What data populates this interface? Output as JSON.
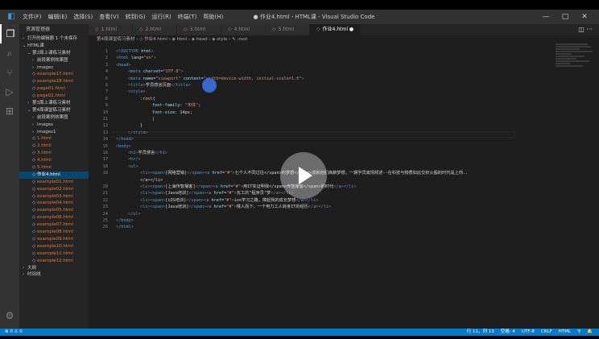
{
  "window": {
    "title": "● 作业4.html - HTML课 - Visual Studio Code",
    "menu": [
      "文件(F)",
      "编辑(E)",
      "选择(S)",
      "查看(V)",
      "转到(G)",
      "运行(R)",
      "终端(T)",
      "帮助(H)"
    ],
    "controls": [
      "—",
      "□",
      "✕"
    ]
  },
  "activity_bar": [
    "files-icon",
    "search-icon",
    "source-control-icon",
    "debug-icon",
    "extensions-icon"
  ],
  "sidebar": {
    "title": "资源管理器",
    "items": [
      {
        "label": "打开的编辑器  1 个未保存",
        "indent": 0,
        "twisty": "›",
        "kind": "folder"
      },
      {
        "label": "HTML课",
        "indent": 0,
        "twisty": "⌄",
        "kind": "folder"
      },
      {
        "label": "第2周上课练习素材",
        "indent": 1,
        "twisty": "⌄",
        "kind": "folder"
      },
      {
        "label": "前段案例效果图",
        "indent": 2,
        "twisty": "›",
        "kind": "folder"
      },
      {
        "label": "images",
        "indent": 2,
        "twisty": "›",
        "kind": "folder"
      },
      {
        "label": "example17.html",
        "indent": 2,
        "twisty": "",
        "kind": "html"
      },
      {
        "label": "example18.html",
        "indent": 2,
        "twisty": "",
        "kind": "html"
      },
      {
        "label": "page01.html",
        "indent": 2,
        "twisty": "",
        "kind": "html"
      },
      {
        "label": "page02.html",
        "indent": 2,
        "twisty": "",
        "kind": "html"
      },
      {
        "label": "第3周上课练习素材",
        "indent": 1,
        "twisty": "›",
        "kind": "folder"
      },
      {
        "label": "第4周课堂练习素材",
        "indent": 1,
        "twisty": "⌄",
        "kind": "folder"
      },
      {
        "label": "前段案例效果图",
        "indent": 2,
        "twisty": "›",
        "kind": "folder"
      },
      {
        "label": "images",
        "indent": 2,
        "twisty": "›",
        "kind": "folder"
      },
      {
        "label": "images1",
        "indent": 2,
        "twisty": "›",
        "kind": "folder"
      },
      {
        "label": "1.html",
        "indent": 2,
        "twisty": "",
        "kind": "html"
      },
      {
        "label": "2.html",
        "indent": 2,
        "twisty": "",
        "kind": "html"
      },
      {
        "label": "3.html",
        "indent": 2,
        "twisty": "",
        "kind": "html"
      },
      {
        "label": "4.html",
        "indent": 2,
        "twisty": "",
        "kind": "html"
      },
      {
        "label": "5.html",
        "indent": 2,
        "twisty": "",
        "kind": "html"
      },
      {
        "label": "作业4.html",
        "indent": 2,
        "twisty": "",
        "kind": "active"
      },
      {
        "label": "example01.html",
        "indent": 2,
        "twisty": "",
        "kind": "html"
      },
      {
        "label": "example02.html",
        "indent": 2,
        "twisty": "",
        "kind": "html"
      },
      {
        "label": "example03.html",
        "indent": 2,
        "twisty": "",
        "kind": "html"
      },
      {
        "label": "example04.html",
        "indent": 2,
        "twisty": "",
        "kind": "html"
      },
      {
        "label": "example05.html",
        "indent": 2,
        "twisty": "",
        "kind": "html"
      },
      {
        "label": "example06.html",
        "indent": 2,
        "twisty": "",
        "kind": "html"
      },
      {
        "label": "example07.html",
        "indent": 2,
        "twisty": "",
        "kind": "html"
      },
      {
        "label": "example08.html",
        "indent": 2,
        "twisty": "",
        "kind": "html"
      },
      {
        "label": "example09.html",
        "indent": 2,
        "twisty": "",
        "kind": "html"
      },
      {
        "label": "example10.html",
        "indent": 2,
        "twisty": "",
        "kind": "html"
      },
      {
        "label": "example11.html",
        "indent": 2,
        "twisty": "",
        "kind": "html"
      },
      {
        "label": "example12.html",
        "indent": 2,
        "twisty": "",
        "kind": "html"
      },
      {
        "label": "大纲",
        "indent": 0,
        "twisty": "›",
        "kind": "folder"
      },
      {
        "label": "时间线",
        "indent": 0,
        "twisty": "›",
        "kind": "folder"
      }
    ]
  },
  "tabs": [
    {
      "label": "1.html",
      "active": false
    },
    {
      "label": "2.html",
      "active": false
    },
    {
      "label": "3.html",
      "active": false
    },
    {
      "label": "4.html",
      "active": false
    },
    {
      "label": "5.html",
      "active": false
    },
    {
      "label": "作业4.html ●",
      "active": true
    }
  ],
  "tab_actions": "◫ ···",
  "breadcrumb": "第4周课堂练习素材 › ◇ 作业4.html › ◈ html › ◈ head › ◈ style › ✎ :root",
  "code_lines": [
    {
      "n": "1",
      "indent": 0,
      "tokens": [
        [
          "pu",
          "<!"
        ],
        [
          "tg",
          "DOCTYPE"
        ],
        [
          "at",
          " html"
        ],
        [
          "pu",
          ">"
        ]
      ]
    },
    {
      "n": "2",
      "indent": 0,
      "tokens": [
        [
          "pu",
          "<"
        ],
        [
          "tg",
          "html"
        ],
        [
          "at",
          " lang"
        ],
        [
          "tx",
          "="
        ],
        [
          "st",
          "\"en\""
        ],
        [
          "pu",
          ">"
        ]
      ]
    },
    {
      "n": "3",
      "indent": 0,
      "tokens": [
        [
          "pu",
          "<"
        ],
        [
          "tg",
          "head"
        ],
        [
          "pu",
          ">"
        ]
      ]
    },
    {
      "n": "4",
      "indent": 1,
      "tokens": [
        [
          "pu",
          "<"
        ],
        [
          "tg",
          "meta"
        ],
        [
          "at",
          " charset"
        ],
        [
          "tx",
          "="
        ],
        [
          "st",
          "\"UTF-8\""
        ],
        [
          "pu",
          ">"
        ]
      ]
    },
    {
      "n": "5",
      "indent": 1,
      "tokens": [
        [
          "pu",
          "<"
        ],
        [
          "tg",
          "meta"
        ],
        [
          "at",
          " name"
        ],
        [
          "tx",
          "="
        ],
        [
          "st",
          "\"viewport\""
        ],
        [
          "at",
          " content"
        ],
        [
          "tx",
          "="
        ],
        [
          "st",
          "\"width=device-width, initial-scale=1.0\""
        ],
        [
          "pu",
          ">"
        ]
      ]
    },
    {
      "n": "6",
      "indent": 1,
      "tokens": [
        [
          "pu",
          "<"
        ],
        [
          "tg",
          "title"
        ],
        [
          "pu",
          ">"
        ],
        [
          "tx",
          "学员感言页面"
        ],
        [
          "pu",
          "</"
        ],
        [
          "tg",
          "title"
        ],
        [
          "pu",
          ">"
        ]
      ]
    },
    {
      "n": "7",
      "indent": 1,
      "tokens": [
        [
          "pu",
          "<"
        ],
        [
          "tg",
          "style"
        ],
        [
          "pu",
          ">"
        ]
      ]
    },
    {
      "n": "8",
      "indent": 2,
      "tokens": [
        [
          "sel",
          ":root"
        ],
        [
          "tx",
          "{"
        ]
      ]
    },
    {
      "n": "9",
      "indent": 3,
      "tokens": [
        [
          "pr",
          "font-family"
        ],
        [
          "tx",
          ": "
        ],
        [
          "st",
          "\"宋体\""
        ],
        [
          "tx",
          ";"
        ]
      ]
    },
    {
      "n": "10",
      "indent": 3,
      "tokens": [
        [
          "pr",
          "font-size"
        ],
        [
          "tx",
          ": 14px;"
        ]
      ]
    },
    {
      "n": "11",
      "indent": 3,
      "tokens": [
        [
          "tx",
          "|"
        ]
      ]
    },
    {
      "n": "12",
      "indent": 2,
      "tokens": [
        [
          "tx",
          "}"
        ]
      ]
    },
    {
      "n": "13",
      "indent": 1,
      "tokens": [
        [
          "pu",
          "</"
        ],
        [
          "tg",
          "style"
        ],
        [
          "pu",
          ">"
        ]
      ]
    },
    {
      "n": "14",
      "indent": 0,
      "tokens": [
        [
          "pu",
          "</"
        ],
        [
          "tg",
          "head"
        ],
        [
          "pu",
          ">"
        ]
      ]
    },
    {
      "n": "15",
      "indent": 0,
      "tokens": [
        [
          "pu",
          "<"
        ],
        [
          "tg",
          "body"
        ],
        [
          "pu",
          ">"
        ]
      ]
    },
    {
      "n": "16",
      "indent": 1,
      "tokens": [
        [
          "pu",
          "<"
        ],
        [
          "tg",
          "h1"
        ],
        [
          "pu",
          ">"
        ],
        [
          "tx",
          "学员感言"
        ],
        [
          "pu",
          "</"
        ],
        [
          "tg",
          "h1"
        ],
        [
          "pu",
          ">"
        ]
      ]
    },
    {
      "n": "17",
      "indent": 1,
      "tokens": [
        [
          "pu",
          "<"
        ],
        [
          "tg",
          "hr"
        ],
        [
          "pu",
          "/>"
        ]
      ]
    },
    {
      "n": "18",
      "indent": 1,
      "tokens": [
        [
          "pu",
          "<"
        ],
        [
          "tg",
          "ul"
        ],
        [
          "pu",
          ">"
        ]
      ]
    },
    {
      "n": "19",
      "indent": 2,
      "tokens": [
        [
          "pu",
          "<"
        ],
        [
          "tg",
          "li"
        ],
        [
          "pu",
          "><"
        ],
        [
          "tg",
          "span"
        ],
        [
          "pu",
          ">"
        ],
        [
          "tx",
          "[网络营销]"
        ],
        [
          "pu",
          "</"
        ],
        [
          "tg",
          "span"
        ],
        [
          "pu",
          "><"
        ],
        [
          "tg",
          "a"
        ],
        [
          "at",
          " href"
        ],
        [
          "tx",
          "="
        ],
        [
          "st",
          "\"#\""
        ],
        [
          "pu",
          ">"
        ],
        [
          "tx",
          "七个人不同过往</span>的梦想</span>成就他们高薪梦想。一期学员真情倾述--在科技与物质如此交织火般的时代是上你.."
        ]
      ]
    },
    {
      "n": "",
      "indent": 2,
      "tokens": [
        [
          "tx",
          "</a></li>"
        ]
      ]
    },
    {
      "n": "20",
      "indent": 2,
      "tokens": [
        [
          "pu",
          "<"
        ],
        [
          "tg",
          "li"
        ],
        [
          "pu",
          "><"
        ],
        [
          "tg",
          "span"
        ],
        [
          "pu",
          ">"
        ],
        [
          "tx",
          "[上海传智播客]"
        ],
        [
          "pu",
          "</"
        ],
        [
          "tg",
          "span"
        ],
        [
          "pu",
          "><"
        ],
        [
          "tg",
          "a"
        ],
        [
          "at",
          " href"
        ],
        [
          "tx",
          "="
        ],
        [
          "st",
          "\"#\""
        ],
        [
          "pu",
          ">"
        ],
        [
          "tx",
          "用IT实证明我</span>传智播客</span>的时代"
        ],
        [
          "pu",
          "</"
        ],
        [
          "tg",
          "a"
        ],
        [
          "pu",
          "></"
        ],
        [
          "tg",
          "li"
        ],
        [
          "pu",
          ">"
        ]
      ]
    },
    {
      "n": "21",
      "indent": 2,
      "tokens": [
        [
          "pu",
          "<"
        ],
        [
          "tg",
          "li"
        ],
        [
          "pu",
          "><"
        ],
        [
          "tg",
          "span"
        ],
        [
          "pu",
          ">"
        ],
        [
          "tx",
          "[Java培训]"
        ],
        [
          "pu",
          "</"
        ],
        [
          "tg",
          "span"
        ],
        [
          "pu",
          "><"
        ],
        [
          "tg",
          "a"
        ],
        [
          "at",
          " href"
        ],
        [
          "tx",
          "="
        ],
        [
          "st",
          "\"#\""
        ],
        [
          "pu",
          ">"
        ],
        [
          "tx",
          "瓦工的\"程序员\"梦"
        ],
        [
          "pu",
          "</"
        ],
        [
          "tg",
          "a"
        ],
        [
          "pu",
          "></"
        ],
        [
          "tg",
          "li"
        ],
        [
          "pu",
          ">"
        ]
      ]
    },
    {
      "n": "22",
      "indent": 2,
      "tokens": [
        [
          "pu",
          "<"
        ],
        [
          "tg",
          "li"
        ],
        [
          "pu",
          "><"
        ],
        [
          "tg",
          "span"
        ],
        [
          "pu",
          ">"
        ],
        [
          "tx",
          "[iOS培训]"
        ],
        [
          "pu",
          "</"
        ],
        [
          "tg",
          "span"
        ],
        [
          "pu",
          "><"
        ],
        [
          "tg",
          "a"
        ],
        [
          "at",
          " href"
        ],
        [
          "tx",
          "="
        ],
        [
          "st",
          "\"#\""
        ],
        [
          "pu",
          ">"
        ],
        [
          "tx",
          "ios学习之路，撑起我的成长梦想"
        ],
        [
          "pu",
          "</"
        ],
        [
          "tg",
          "a"
        ],
        [
          "pu",
          "></"
        ],
        [
          "tg",
          "li"
        ],
        [
          "pu",
          ">"
        ]
      ]
    },
    {
      "n": "23",
      "indent": 2,
      "tokens": [
        [
          "pu",
          "<"
        ],
        [
          "tg",
          "li"
        ],
        [
          "pu",
          "><"
        ],
        [
          "tg",
          "span"
        ],
        [
          "pu",
          ">"
        ],
        [
          "tx",
          "[Java培训]"
        ],
        [
          "pu",
          "</"
        ],
        [
          "tg",
          "span"
        ],
        [
          "pu",
          "><"
        ],
        [
          "tg",
          "a"
        ],
        [
          "at",
          " href"
        ],
        [
          "tx",
          "="
        ],
        [
          "st",
          "\"#\""
        ],
        [
          "pu",
          ">"
        ],
        [
          "tx",
          "慢人而下，一个电力工人转身IT的经历"
        ],
        [
          "pu",
          "</"
        ],
        [
          "tg",
          "a"
        ],
        [
          "pu",
          "></"
        ],
        [
          "tg",
          "li"
        ],
        [
          "pu",
          ">"
        ]
      ]
    },
    {
      "n": "24",
      "indent": 1,
      "tokens": [
        [
          "pu",
          "</"
        ],
        [
          "tg",
          "ul"
        ],
        [
          "pu",
          ">"
        ]
      ]
    },
    {
      "n": "25",
      "indent": 0,
      "tokens": [
        [
          "pu",
          "</"
        ],
        [
          "tg",
          "body"
        ],
        [
          "pu",
          ">"
        ]
      ]
    },
    {
      "n": "26",
      "indent": 0,
      "tokens": [
        [
          "pu",
          "</"
        ],
        [
          "tg",
          "html"
        ],
        [
          "pu",
          ">"
        ]
      ]
    }
  ],
  "status": {
    "left": "⊗ 0  ⚠ 0",
    "right": [
      "行 11，列 13",
      "空格: 4",
      "UTF-8",
      "CRLF",
      "HTML",
      "⚲",
      "🔔"
    ]
  },
  "overlay": {
    "play_icon": "play-icon"
  },
  "colors": {
    "accent": "#007acc",
    "editor_bg": "#1e1e1e",
    "sidebar_bg": "#252526",
    "activity_bg": "#333333"
  }
}
